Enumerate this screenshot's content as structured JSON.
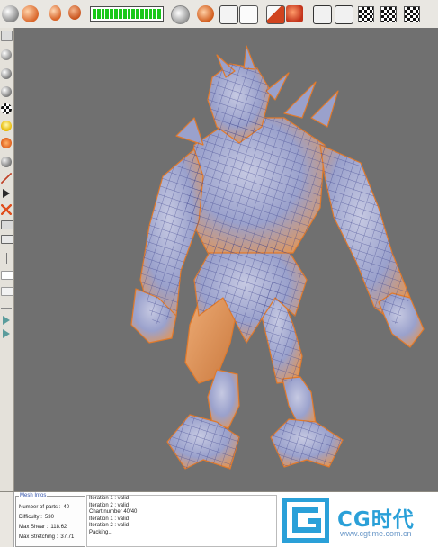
{
  "toolbar": {
    "progress": {
      "segments": 16,
      "filled_fraction": 1.0,
      "color": "#18c818"
    },
    "icons": [
      "sphere-tool-icon",
      "sphere-orange-icon",
      "egg-icon",
      "shape-icon",
      "progress-bar",
      "arrow-cycle-icon",
      "play-orange-icon",
      "link-nodes-icon",
      "brush-icon",
      "red-shape-icon",
      "paint-icon",
      "axis-transform-icon",
      "move-axis-icon",
      "checker-map-icon",
      "checker-map-2-icon",
      "checker-map-3-icon"
    ]
  },
  "mesh_infos": {
    "title": "Mesh Infos",
    "rows": [
      {
        "label": "Number of parts :",
        "value": "40"
      },
      {
        "label": "Difficulty :",
        "value": "530"
      },
      {
        "label": "Max Shear :",
        "value": "118.62"
      },
      {
        "label": "Max Stretching :",
        "value": "37.71"
      }
    ]
  },
  "log": {
    "lines": [
      "Iteration 1 : valid",
      "Iteration 2 : valid",
      "Chart number 40/40",
      "Iteration 1 : valid",
      "Iteration 2 : valid",
      "Packing..."
    ]
  },
  "watermark": {
    "brand": "CG时代",
    "url": "www.cgtime.com.cn",
    "color": "#2aa0d8"
  },
  "colors": {
    "viewport_bg": "#707070",
    "mesh_orange": "#e79250",
    "mesh_blue": "#8d98c9",
    "wire": "#3a3f8a"
  }
}
